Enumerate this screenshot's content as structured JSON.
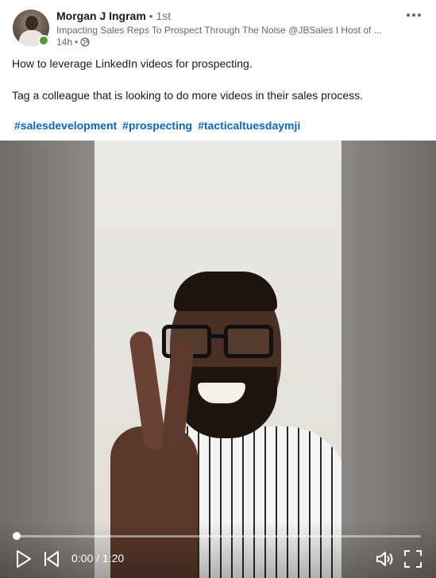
{
  "post": {
    "author": {
      "name": "Morgan J Ingram",
      "degree": "• 1st",
      "headline": "Impacting Sales Reps To Prospect Through The Noise @JBSales I Host of ...",
      "time": "14h",
      "separator": "•",
      "visibility_icon": "globe-icon",
      "presence_color": "#4f9a3a"
    },
    "menu_icon": "more-icon",
    "text_line1": "How to leverage LinkedIn videos for prospecting.",
    "text_line2": "Tag a colleague that is looking to do more videos in their sales process.",
    "hashtags": [
      "#salesdevelopment",
      "#prospecting",
      "#tacticaltuesdaymji"
    ],
    "hashtag_color": "#0a66c2"
  },
  "video": {
    "progress_fraction": 0.0,
    "time_display": "0:00 / 1:20",
    "controls": {
      "play_icon": "play-icon",
      "previous_icon": "skip-back-icon",
      "volume_icon": "volume-icon",
      "fullscreen_icon": "fullscreen-icon"
    }
  }
}
